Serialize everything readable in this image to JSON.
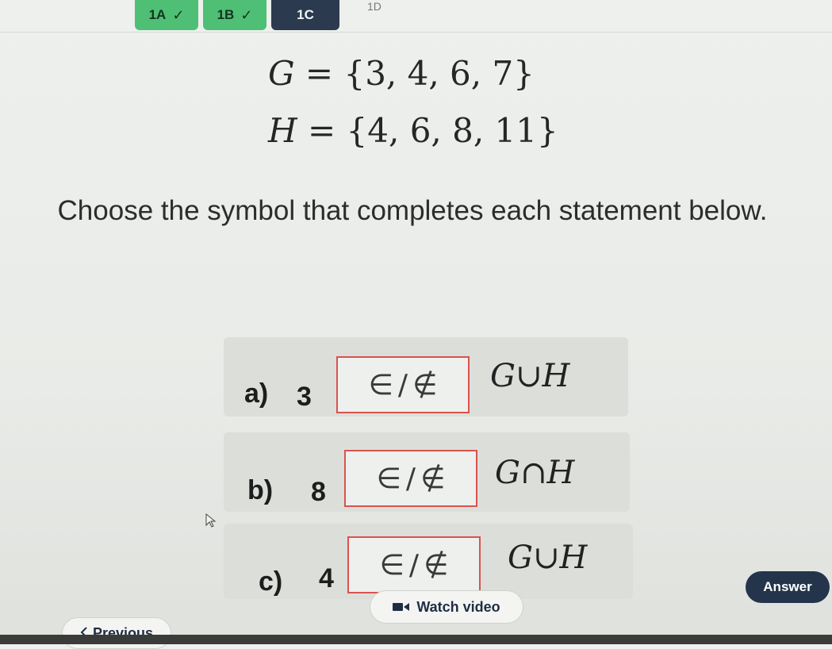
{
  "tabs": [
    {
      "label": "1A",
      "status": "done"
    },
    {
      "label": "1B",
      "status": "done"
    },
    {
      "label": "1C",
      "status": "active"
    }
  ],
  "tab_more": "1D",
  "sets": {
    "g": {
      "var": "G",
      "eq": " = ",
      "values": "{3, 4, 6, 7}"
    },
    "h": {
      "var": "H",
      "eq": " = ",
      "values": "{4, 6, 8, 11}"
    }
  },
  "instructions": "Choose the symbol that completes each statement below.",
  "questions": [
    {
      "label": "a)",
      "element": "3",
      "options": [
        "∈",
        "∉"
      ],
      "set_expr": "G∪H"
    },
    {
      "label": "b)",
      "element": "8",
      "options": [
        "∈",
        "∉"
      ],
      "set_expr": "G∩H"
    },
    {
      "label": "c)",
      "element": "4",
      "options": [
        "∈",
        "∉"
      ],
      "set_expr": "G∪H"
    }
  ],
  "buttons": {
    "answer": "Answer",
    "watch_video": "Watch video",
    "previous": "Previous"
  },
  "colors": {
    "tab_done": "#4fbf76",
    "tab_active": "#2b3a4f",
    "selector_border": "#d9534f",
    "answer_button": "#23344b"
  },
  "icons": [
    "check-icon",
    "video-icon",
    "chevron-left-icon",
    "mouse-cursor-icon"
  ]
}
